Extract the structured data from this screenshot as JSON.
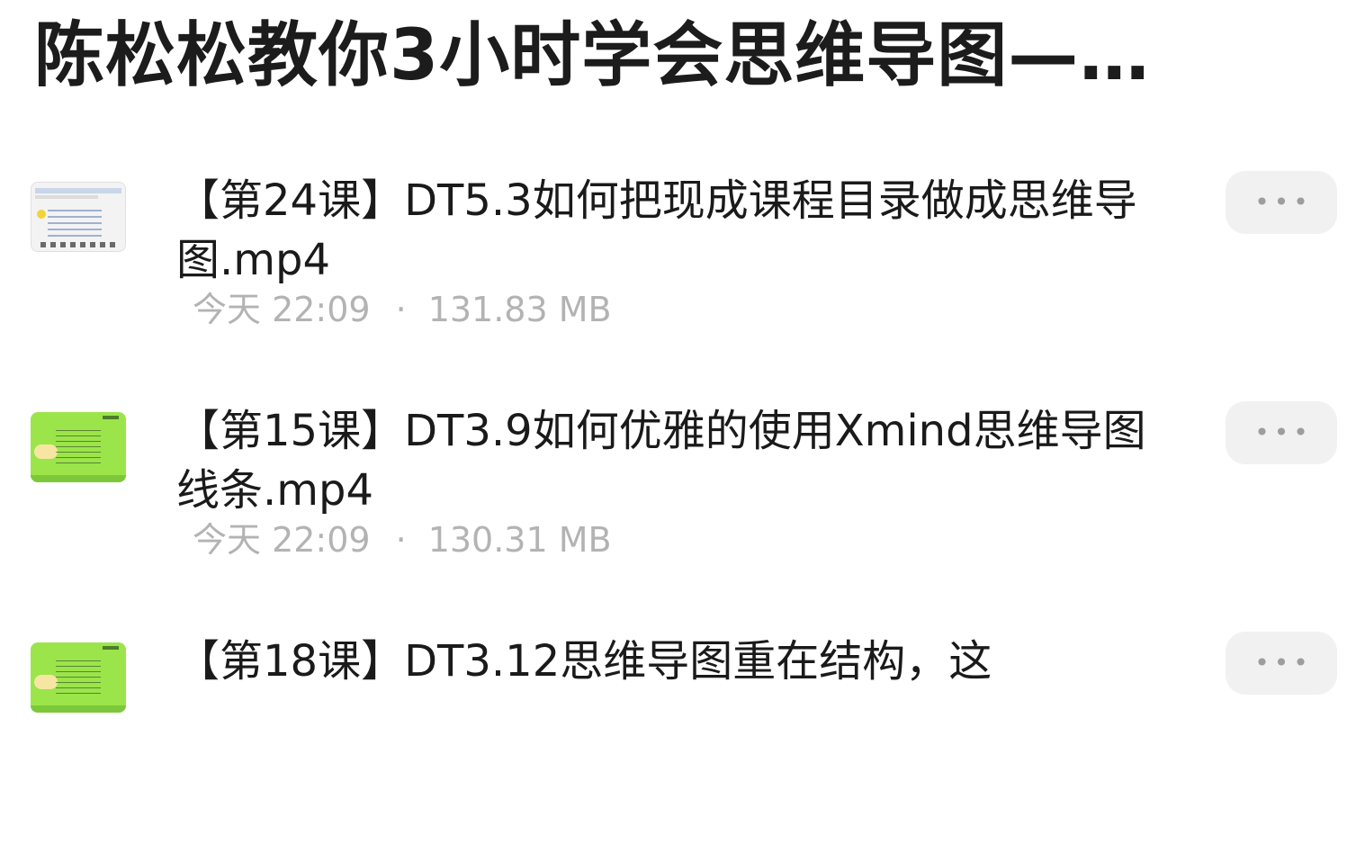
{
  "folder": {
    "title": "陈松松教你3小时学会思维导图—…"
  },
  "files": [
    {
      "name": "【第24课】DT5.3如何把现成课程目录做成思维导图.mp4",
      "time": "今天 22:09",
      "separator": "·",
      "size": "131.83 MB",
      "thumbnail": "screenshot",
      "more_icon": "more-horizontal-icon",
      "more_label": "•••"
    },
    {
      "name": "【第15课】DT3.9如何优雅的使用Xmind思维导图线条.mp4",
      "time": "今天 22:09",
      "separator": "·",
      "size": "130.31 MB",
      "thumbnail": "mindmap",
      "more_icon": "more-horizontal-icon",
      "more_label": "•••"
    },
    {
      "name": "【第18课】DT3.12思维导图重在结构，这",
      "thumbnail": "mindmap",
      "more_icon": "more-horizontal-icon",
      "more_label": "•••"
    }
  ],
  "colors": {
    "thumbnail_green": "#9be54a",
    "meta_gray": "#b3b3b3",
    "button_bg": "#f1f1f1"
  }
}
